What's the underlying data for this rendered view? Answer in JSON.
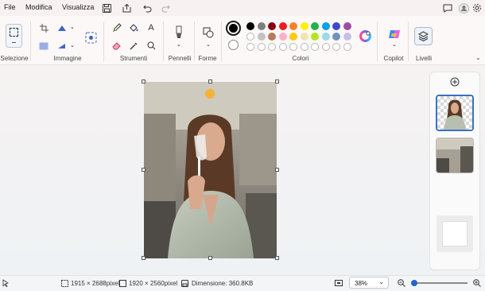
{
  "menu": {
    "file": "File",
    "edit": "Modifica",
    "view": "Visualizza"
  },
  "ribbon": {
    "groups": {
      "selection": "Selezione",
      "image": "Immagine",
      "tools": "Strumenti",
      "brushes": "Pennelli",
      "shapes": "Forme",
      "colors": "Colori",
      "copilot": "Copilot",
      "layers": "Livelli"
    },
    "palette": {
      "row1": [
        "#000000",
        "#7f7f7f",
        "#880015",
        "#ed1c24",
        "#ff7f27",
        "#fff200",
        "#22b14c",
        "#00a2e8",
        "#3f48cc",
        "#a349a4"
      ],
      "row2": [
        "#ffffff",
        "#c3c3c3",
        "#b97a57",
        "#ffaec9",
        "#ffc90e",
        "#efe4b0",
        "#b5e61d",
        "#99d9ea",
        "#7092be",
        "#c8bfe7"
      ]
    },
    "primary_color": "#000000",
    "secondary_color": "#ffffff"
  },
  "status": {
    "selection_size": "1915 × 2688pixel",
    "canvas_size": "1920 × 2560pixel",
    "file_size": "Dimensione: 360.8KB",
    "zoom": "38%"
  },
  "icons": [
    "undo-icon",
    "redo-icon",
    "save-icon",
    "share-icon",
    "comment-icon",
    "avatar",
    "settings-gear-icon",
    "pencil-icon",
    "fill-bucket-icon",
    "text-icon",
    "eraser-icon",
    "color-picker-icon",
    "magnifier-icon",
    "brush-icon",
    "shapes-icon",
    "edit-colors-icon",
    "copilot-icon",
    "layers-icon",
    "crop-icon",
    "rotate-icon",
    "flip-icon",
    "resize-icon",
    "background-remove-icon",
    "add-layer-icon"
  ]
}
